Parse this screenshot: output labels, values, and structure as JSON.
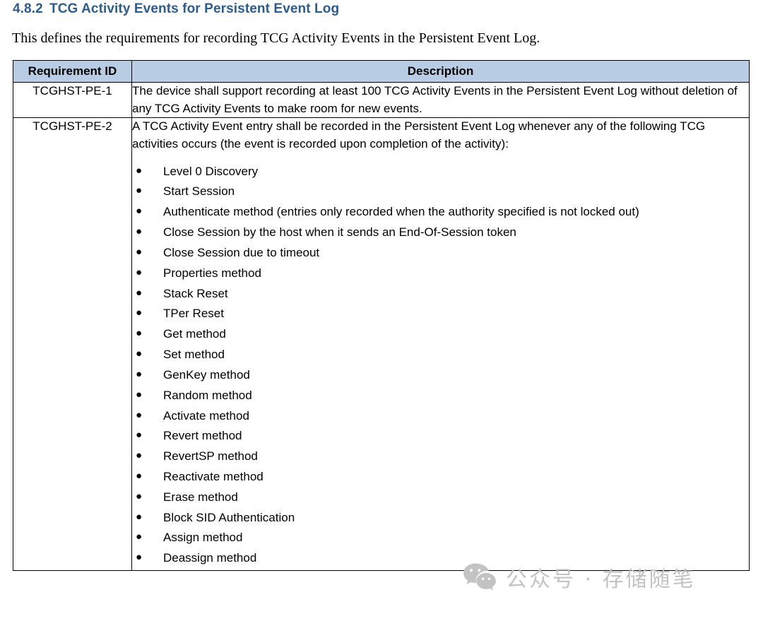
{
  "heading": {
    "number": "4.8.2",
    "title": "TCG Activity Events for Persistent Event Log",
    "color": "#2e5c8a"
  },
  "intro": {
    "text": "This defines the requirements for recording TCG Activity Events in the Persistent Event Log."
  },
  "table": {
    "header_fill": "#b8cce4",
    "columns": [
      {
        "label": "Requirement ID"
      },
      {
        "label": "Description"
      }
    ],
    "rows": [
      {
        "id": "TCGHST-PE-1",
        "description": "The device shall support recording at least 100 TCG Activity Events in the Persistent Event Log without deletion of any TCG Activity Events to make room for new events.",
        "bullets": []
      },
      {
        "id": "TCGHST-PE-2",
        "description": "A TCG Activity Event entry shall be recorded in the Persistent Event Log whenever any of the following TCG activities occurs (the event is recorded upon completion of the activity):",
        "bullets": [
          "Level 0 Discovery",
          "Start Session",
          "Authenticate method (entries only recorded when the authority specified is not locked out)",
          "Close Session by the host when it sends an End-Of-Session token",
          "Close Session due to timeout",
          "Properties method",
          "Stack Reset",
          "TPer Reset",
          "Get method",
          "Set method",
          "GenKey method",
          "Random method",
          "Activate method",
          "Revert method",
          "RevertSP method",
          "Reactivate method",
          "Erase method",
          "Block SID Authentication",
          "Assign method",
          "Deassign method"
        ]
      }
    ]
  },
  "watermark": {
    "icon": "wechat-icon",
    "text": "公众号 · 存储随笔",
    "color": "#c3c3c3"
  }
}
